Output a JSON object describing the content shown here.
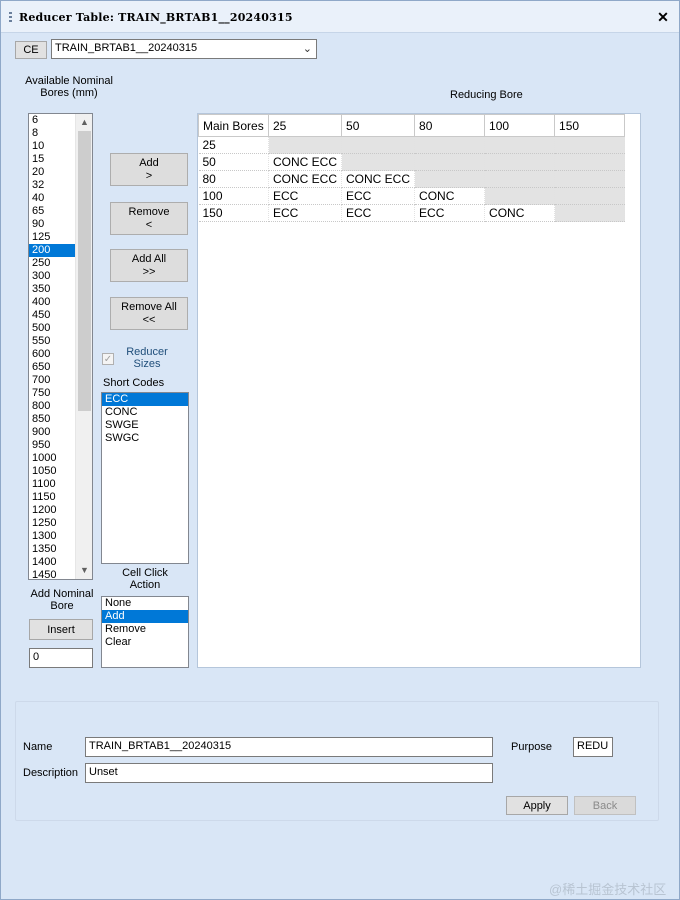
{
  "window": {
    "title": "Reducer Table: TRAIN_BRTAB1__20240315",
    "close_glyph": "✕"
  },
  "toolbar": {
    "ce_label": "CE",
    "table_select": "TRAIN_BRTAB1__20240315"
  },
  "available": {
    "label": "Available Nominal Bores (mm)",
    "items": [
      "6",
      "8",
      "10",
      "15",
      "20",
      "32",
      "40",
      "65",
      "90",
      "125",
      "200",
      "250",
      "300",
      "350",
      "400",
      "450",
      "500",
      "550",
      "600",
      "650",
      "700",
      "750",
      "800",
      "850",
      "900",
      "950",
      "1000",
      "1050",
      "1100",
      "1150",
      "1200",
      "1250",
      "1300",
      "1350",
      "1400",
      "1450"
    ],
    "selected": "200"
  },
  "buttons": {
    "add": "Add",
    "add_sub": ">",
    "remove": "Remove",
    "remove_sub": "<",
    "add_all": "Add All",
    "add_all_sub": ">>",
    "remove_all": "Remove All",
    "remove_all_sub": "<<",
    "insert": "Insert",
    "apply": "Apply",
    "back": "Back"
  },
  "reducer_sizes": {
    "label": "Reducer Sizes",
    "checked": true
  },
  "short_codes": {
    "label": "Short Codes",
    "items": [
      "ECC",
      "CONC",
      "SWGE",
      "SWGC"
    ],
    "selected": "ECC"
  },
  "add_nominal": {
    "label": "Add Nominal Bore",
    "value": "0"
  },
  "cell_click": {
    "label": "Cell Click Action",
    "items": [
      "None",
      "Add",
      "Remove",
      "Clear"
    ],
    "selected": "Add"
  },
  "table": {
    "heading": "Reducing Bore",
    "corner": "Main Bores",
    "columns": [
      "25",
      "50",
      "80",
      "100",
      "150"
    ],
    "rows": [
      {
        "main": "25",
        "cells": [
          "",
          "",
          "",
          "",
          ""
        ],
        "grey": [
          true,
          true,
          true,
          true,
          true
        ]
      },
      {
        "main": "50",
        "cells": [
          "CONC ECC",
          "",
          "",
          "",
          ""
        ],
        "grey": [
          false,
          true,
          true,
          true,
          true
        ]
      },
      {
        "main": "80",
        "cells": [
          "CONC ECC",
          "CONC ECC",
          "",
          "",
          ""
        ],
        "grey": [
          false,
          false,
          true,
          true,
          true
        ]
      },
      {
        "main": "100",
        "cells": [
          "ECC",
          "ECC",
          "CONC",
          "",
          ""
        ],
        "grey": [
          false,
          false,
          false,
          true,
          true
        ]
      },
      {
        "main": "150",
        "cells": [
          "ECC",
          "ECC",
          "ECC",
          "CONC",
          ""
        ],
        "grey": [
          false,
          false,
          false,
          false,
          true
        ]
      }
    ]
  },
  "form": {
    "name_label": "Name",
    "name_value": "TRAIN_BRTAB1__20240315",
    "description_label": "Description",
    "description_value": "Unset",
    "purpose_label": "Purpose",
    "purpose_value": "REDU"
  },
  "watermark": "@稀土掘金技术社区",
  "colors": {
    "selection": "#0078d7",
    "window_bg": "#d9e6f6",
    "disabled_cell": "#e3e3e3"
  }
}
